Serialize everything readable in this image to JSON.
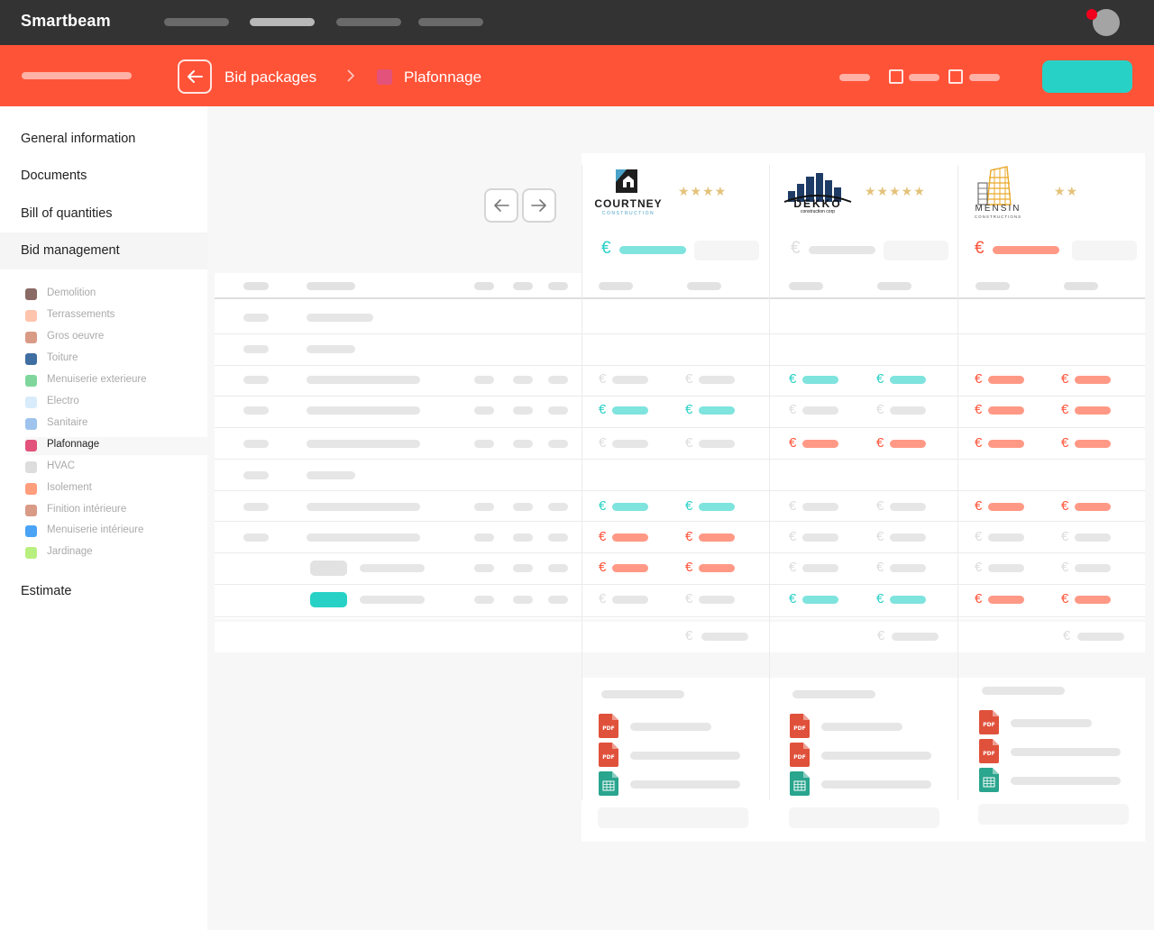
{
  "app": {
    "brand": "Smartbeam"
  },
  "breadcrumb": {
    "parent": "Bid packages",
    "current": "Plafonnage"
  },
  "sidebar": {
    "items": [
      {
        "label": "General information"
      },
      {
        "label": "Documents"
      },
      {
        "label": "Bill of quantities"
      },
      {
        "label": "Bid management"
      },
      {
        "label": "Estimate"
      }
    ],
    "categories": [
      {
        "label": "Demolition",
        "color": "#8a6a64"
      },
      {
        "label": "Terrassements",
        "color": "#ffc4ad"
      },
      {
        "label": "Gros oeuvre",
        "color": "#d99a86"
      },
      {
        "label": "Toiture",
        "color": "#3f6ea3"
      },
      {
        "label": "Menuiserie exterieure",
        "color": "#7ed69c"
      },
      {
        "label": "Electro",
        "color": "#d8ecfb"
      },
      {
        "label": "Sanitaire",
        "color": "#9ec3ec"
      },
      {
        "label": "Plafonnage",
        "color": "#e2527a"
      },
      {
        "label": "HVAC",
        "color": "#dddddd"
      },
      {
        "label": "Isolement",
        "color": "#ff9e7d"
      },
      {
        "label": "Finition intérieure",
        "color": "#d99a86"
      },
      {
        "label": "Menuiserie intérieure",
        "color": "#4aa3f5"
      },
      {
        "label": "Jardinage",
        "color": "#b8f07f"
      }
    ]
  },
  "bidders": [
    {
      "name": "COURTNEY",
      "sub": "CONSTRUCTION",
      "stars": "★★★★"
    },
    {
      "name": "DEKKO",
      "sub": "construction corp",
      "stars": "★★★★★"
    },
    {
      "name": "MENSIN",
      "sub": "CONSTRUCTIONS",
      "stars": "★★"
    }
  ],
  "symbols": {
    "euro": "€",
    "file_pdf": "PDF"
  },
  "colors": {
    "teal": "#28d1c6",
    "salmon": "#ff5338",
    "bar_teal": "#7fe3de",
    "bar_salmon": "#ff9986",
    "bar_grey": "#e6e6e6"
  }
}
